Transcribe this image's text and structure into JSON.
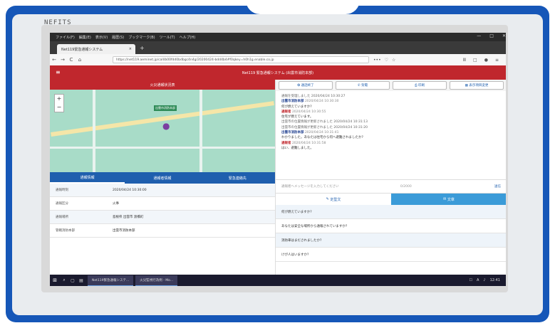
{
  "photo": {
    "brand": "NEFITS"
  },
  "menubar": [
    "ファイル(F)",
    "編集(E)",
    "表示(V)",
    "履歴(S)",
    "ブックマーク(B)",
    "ツール(T)",
    "ヘルプ(H)"
  ],
  "window_controls": [
    "—",
    "□",
    "✕"
  ],
  "browser": {
    "tab_title": "Net119緊急通報システム",
    "tab_close": "×",
    "new_tab": "+",
    "url": "https://net119.aeminet.jp/call/b00fdd0bdbgc4n4g/20200424-bdd4b4#f0qkey=h0h1g.enable.co.jp",
    "url_icons": [
      "•••",
      "♡",
      "☆"
    ],
    "right_icons": [
      "Ⅲ",
      "□",
      "●",
      "≡"
    ],
    "nav": [
      "←",
      "→",
      "C",
      "⌂"
    ]
  },
  "app": {
    "hamburger": "≡",
    "title": "Net119 緊急通報システム (出雲市消防本部)",
    "map_title": "火災通報状況表",
    "map_label": "出雲市消防本部",
    "map_zoom_in": "+",
    "map_zoom_out": "−",
    "detail_tabs": [
      "通報情報",
      "通報者情報",
      "緊急連絡先"
    ],
    "details": [
      {
        "k": "通報時刻",
        "v": "2020/04/24 10:30:00"
      },
      {
        "k": "通報区分",
        "v": "火事"
      },
      {
        "k": "通報場所",
        "v": "島根県 出雲市 渡橋町"
      },
      {
        "k": "管轄消防本部",
        "v": "出雲市消防本部"
      }
    ]
  },
  "actions": [
    {
      "icon": "✪",
      "label": "通話終了"
    },
    {
      "icon": "✆",
      "label": "架電"
    },
    {
      "icon": "⎙",
      "label": "印刷"
    },
    {
      "icon": "▦",
      "label": "表示項目変更"
    }
  ],
  "chat": [
    {
      "type": "sys",
      "text": "通報を受理しました 2020/04/24 10:30:27"
    },
    {
      "type": "hq",
      "who": "出雲市消防本部",
      "time": "2020/04/24 10:30:30",
      "text": "何が燃えていますか?"
    },
    {
      "type": "caller",
      "who": "通報者",
      "time": "2020/04/24 10:30:55",
      "text": "住宅が燃えています。"
    },
    {
      "type": "sys",
      "text": "出雲市の位置情報が更新されました 2020/04/24 10:31:13"
    },
    {
      "type": "sys",
      "text": "出雲市の位置情報が更新されました 2020/04/24 10:31:20"
    },
    {
      "type": "hq",
      "who": "出雲市消防本部",
      "time": "2020/04/24 10:31:41",
      "text": "わかりました。あなたは住宅から何へ避難されましたか?"
    },
    {
      "type": "caller",
      "who": "通報者",
      "time": "2020/04/24 10:31:58",
      "text": "はい、避難しました。"
    }
  ],
  "input": {
    "placeholder": "通報者へメッセージを入力してください",
    "count": "0/2000",
    "send": "送信"
  },
  "question_tabs": {
    "a": "定型文",
    "b": "文章"
  },
  "questions": [
    "何が燃えていますか?",
    "あなたは安全な場所から通報されていますか?",
    "消防車はまだされましたか?",
    "けが人はいますか?"
  ],
  "taskbar": {
    "start": "⊞",
    "icons": [
      "⌕",
      "▢",
      "▤"
    ],
    "apps": [
      "Net119緊急通報システ...",
      "火災監視行為例 - Mo..."
    ],
    "tray": [
      "☐",
      "A",
      "♪",
      "12:41"
    ]
  }
}
